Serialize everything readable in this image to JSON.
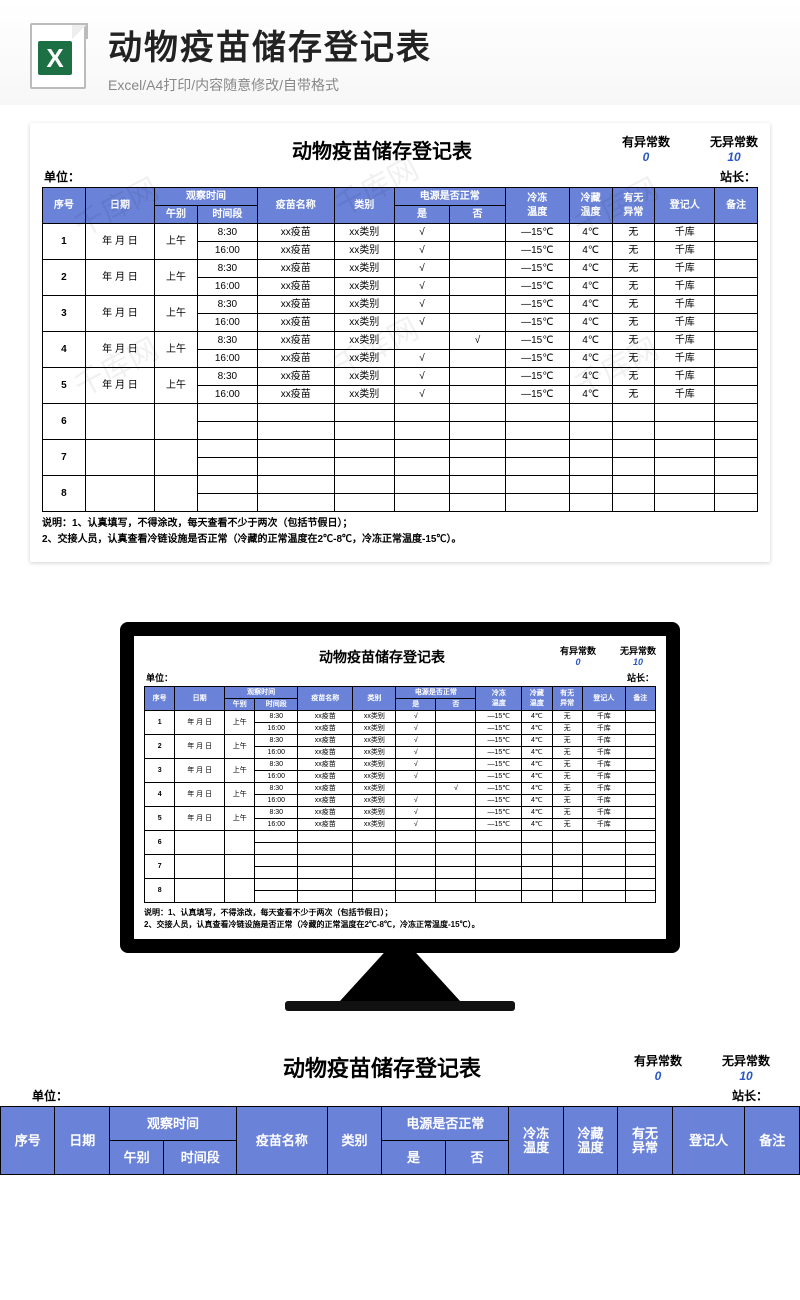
{
  "hero": {
    "title": "动物疫苗储存登记表",
    "subtitle": "Excel/A4打印/内容随意修改/自带格式",
    "icon_letter": "X"
  },
  "doc": {
    "title": "动物疫苗储存登记表",
    "stat_abn_label": "有异常数",
    "stat_abn_value": "0",
    "stat_norm_label": "无异常数",
    "stat_norm_value": "10",
    "unit_label": "单位：",
    "leader_label": "站长：",
    "headers": {
      "seq": "序号",
      "date": "日期",
      "obs": "观察时间",
      "period": "午别",
      "time": "时间段",
      "vname": "疫苗名称",
      "cat": "类别",
      "power": "电源是否正常",
      "yes": "是",
      "no": "否",
      "frz": "冷冻\n温度",
      "cold": "冷藏\n温度",
      "abn": "有无\n异常",
      "reg": "登记人",
      "remark": "备注"
    },
    "rows": [
      {
        "seq": "1",
        "date": "年 月 日",
        "period": "上午",
        "time": "8:30",
        "vname": "xx疫苗",
        "cat": "xx类别",
        "yes": "√",
        "no": "",
        "frz": "—15℃",
        "cold": "4℃",
        "abn": "无",
        "reg": "千库",
        "remark": ""
      },
      {
        "seq": "",
        "date": "",
        "period": "",
        "time": "16:00",
        "vname": "xx疫苗",
        "cat": "xx类别",
        "yes": "√",
        "no": "",
        "frz": "—15℃",
        "cold": "4℃",
        "abn": "无",
        "reg": "千库",
        "remark": ""
      },
      {
        "seq": "2",
        "date": "年 月 日",
        "period": "上午",
        "time": "8:30",
        "vname": "xx疫苗",
        "cat": "xx类别",
        "yes": "√",
        "no": "",
        "frz": "—15℃",
        "cold": "4℃",
        "abn": "无",
        "reg": "千库",
        "remark": ""
      },
      {
        "seq": "",
        "date": "",
        "period": "",
        "time": "16:00",
        "vname": "xx疫苗",
        "cat": "xx类别",
        "yes": "√",
        "no": "",
        "frz": "—15℃",
        "cold": "4℃",
        "abn": "无",
        "reg": "千库",
        "remark": ""
      },
      {
        "seq": "3",
        "date": "年 月 日",
        "period": "上午",
        "time": "8:30",
        "vname": "xx疫苗",
        "cat": "xx类别",
        "yes": "√",
        "no": "",
        "frz": "—15℃",
        "cold": "4℃",
        "abn": "无",
        "reg": "千库",
        "remark": ""
      },
      {
        "seq": "",
        "date": "",
        "period": "",
        "time": "16:00",
        "vname": "xx疫苗",
        "cat": "xx类别",
        "yes": "√",
        "no": "",
        "frz": "—15℃",
        "cold": "4℃",
        "abn": "无",
        "reg": "千库",
        "remark": ""
      },
      {
        "seq": "4",
        "date": "年 月 日",
        "period": "上午",
        "time": "8:30",
        "vname": "xx疫苗",
        "cat": "xx类别",
        "yes": "",
        "no": "√",
        "frz": "—15℃",
        "cold": "4℃",
        "abn": "无",
        "reg": "千库",
        "remark": ""
      },
      {
        "seq": "",
        "date": "",
        "period": "",
        "time": "16:00",
        "vname": "xx疫苗",
        "cat": "xx类别",
        "yes": "√",
        "no": "",
        "frz": "—15℃",
        "cold": "4℃",
        "abn": "无",
        "reg": "千库",
        "remark": ""
      },
      {
        "seq": "5",
        "date": "年 月 日",
        "period": "上午",
        "time": "8:30",
        "vname": "xx疫苗",
        "cat": "xx类别",
        "yes": "√",
        "no": "",
        "frz": "—15℃",
        "cold": "4℃",
        "abn": "无",
        "reg": "千库",
        "remark": ""
      },
      {
        "seq": "",
        "date": "",
        "period": "",
        "time": "16:00",
        "vname": "xx疫苗",
        "cat": "xx类别",
        "yes": "√",
        "no": "",
        "frz": "—15℃",
        "cold": "4℃",
        "abn": "无",
        "reg": "千库",
        "remark": ""
      },
      {
        "seq": "6",
        "date": "",
        "period": "",
        "time": "",
        "vname": "",
        "cat": "",
        "yes": "",
        "no": "",
        "frz": "",
        "cold": "",
        "abn": "",
        "reg": "",
        "remark": ""
      },
      {
        "seq": "",
        "date": "",
        "period": "",
        "time": "",
        "vname": "",
        "cat": "",
        "yes": "",
        "no": "",
        "frz": "",
        "cold": "",
        "abn": "",
        "reg": "",
        "remark": ""
      },
      {
        "seq": "7",
        "date": "",
        "period": "",
        "time": "",
        "vname": "",
        "cat": "",
        "yes": "",
        "no": "",
        "frz": "",
        "cold": "",
        "abn": "",
        "reg": "",
        "remark": ""
      },
      {
        "seq": "",
        "date": "",
        "period": "",
        "time": "",
        "vname": "",
        "cat": "",
        "yes": "",
        "no": "",
        "frz": "",
        "cold": "",
        "abn": "",
        "reg": "",
        "remark": ""
      },
      {
        "seq": "8",
        "date": "",
        "period": "",
        "time": "",
        "vname": "",
        "cat": "",
        "yes": "",
        "no": "",
        "frz": "",
        "cold": "",
        "abn": "",
        "reg": "",
        "remark": ""
      },
      {
        "seq": "",
        "date": "",
        "period": "",
        "time": "",
        "vname": "",
        "cat": "",
        "yes": "",
        "no": "",
        "frz": "",
        "cold": "",
        "abn": "",
        "reg": "",
        "remark": ""
      }
    ],
    "note1": "说明：1、认真填写，不得涂改，每天查看不少于两次（包括节假日）；",
    "note2": "2、交接人员，认真查看冷链设施是否正常（冷藏的正常温度在2℃-8℃，冷冻正常温度-15℃）。",
    "watermark": "千库网"
  }
}
